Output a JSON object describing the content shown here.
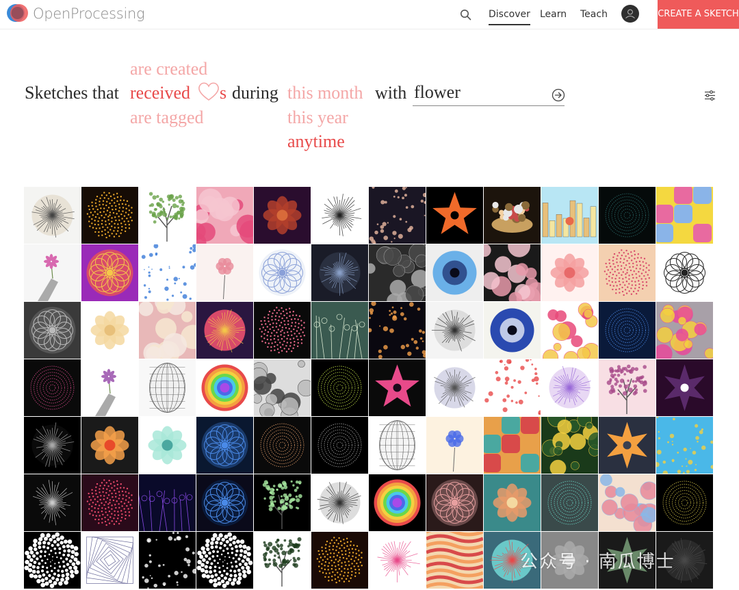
{
  "header": {
    "logo_text": "OpenProcessing",
    "nav": [
      {
        "label": "Discover",
        "active": true
      },
      {
        "label": "Learn",
        "active": false
      },
      {
        "label": "Teach",
        "active": false
      }
    ],
    "search_icon": "search-icon",
    "avatar_icon": "user-avatar-icon",
    "create_button": "CREATE A SKETCH",
    "accent_color": "#ef5a5a"
  },
  "query": {
    "prefix": "Sketches that",
    "action_options_above": [
      "are created"
    ],
    "action_selected": "received",
    "action_heart_icon": "heart-icon",
    "action_suffix": "s",
    "action_options_below": [
      "are tagged"
    ],
    "during": "during",
    "time_selected": "this month",
    "time_options_below": [
      "this year",
      "anytime"
    ],
    "with": "with",
    "search_value": "flower",
    "search_go_icon": "arrow-right-circle-icon",
    "filter_icon": "sliders-icon"
  },
  "grid": {
    "columns": 12,
    "rows": 7,
    "tiles": [
      {
        "bg": "#f4f4f2",
        "fg": "#e8e2d6",
        "mark": "#444",
        "kind": "burst"
      },
      {
        "bg": "#160c05",
        "fg": "#2a1a08",
        "mark": "#e8a62a",
        "kind": "dots"
      },
      {
        "bg": "#ffffff",
        "fg": "#ffffff",
        "mark": "#6aa24a",
        "kind": "tree"
      },
      {
        "bg": "#f0a8b8",
        "fg": "#f6c6d0",
        "mark": "#e44a7a",
        "kind": "petals"
      },
      {
        "bg": "#2a0d2e",
        "fg": "#b3402c",
        "mark": "#d86a3a",
        "kind": "bloom"
      },
      {
        "bg": "#ffffff",
        "fg": "#ffffff",
        "mark": "#222",
        "kind": "burst"
      },
      {
        "bg": "#1a1624",
        "fg": "#1a1624",
        "mark": "#e8b8a0",
        "kind": "scatter"
      },
      {
        "bg": "#000000",
        "fg": "#000000",
        "mark": "#f06a2a",
        "kind": "star5"
      },
      {
        "bg": "#1c140c",
        "fg": "#3a2a16",
        "mark": "#c8a060",
        "kind": "basket"
      },
      {
        "bg": "#b8e6f4",
        "fg": "#f4e6a0",
        "mark": "#e86a4a",
        "kind": "city"
      },
      {
        "bg": "#050a0a",
        "fg": "#0c1616",
        "mark": "#2a6a6a",
        "kind": "rings"
      },
      {
        "bg": "#f4d840",
        "fg": "#e86aa0",
        "mark": "#8ab4e8",
        "kind": "blocks"
      },
      {
        "bg": "#f6f6f6",
        "fg": "#dddddd",
        "mark": "#d86ab0",
        "kind": "hand"
      },
      {
        "bg": "#9a2ab8",
        "fg": "#d84a6a",
        "mark": "#f4c84a",
        "kind": "mandala"
      },
      {
        "bg": "#ffffff",
        "fg": "#ffffff",
        "mark": "#3a7ad8",
        "kind": "scatter"
      },
      {
        "bg": "#faf2f0",
        "fg": "#faf2f0",
        "mark": "#e88a9a",
        "kind": "single"
      },
      {
        "bg": "#ffffff",
        "fg": "#eef2f8",
        "mark": "#8aa0d8",
        "kind": "mandala"
      },
      {
        "bg": "#1a1c28",
        "fg": "#2a3040",
        "mark": "#8aa0c8",
        "kind": "burst"
      },
      {
        "bg": "#2a2a2a",
        "fg": "#4a4a4a",
        "mark": "#aaaaaa",
        "kind": "bubbles"
      },
      {
        "bg": "#eeeeee",
        "fg": "#6ab0e8",
        "mark": "#1a2a6a",
        "kind": "eye"
      },
      {
        "bg": "#1a1a1a",
        "fg": "#f4c6d0",
        "mark": "#e89aaa",
        "kind": "petals"
      },
      {
        "bg": "#fff2f0",
        "fg": "#f4a0a0",
        "mark": "#e86a6a",
        "kind": "bloom"
      },
      {
        "bg": "#f4d0b0",
        "fg": "#e8a07a",
        "mark": "#d84a6a",
        "kind": "dots"
      },
      {
        "bg": "#ffffff",
        "fg": "#ffffff",
        "mark": "#222",
        "kind": "mandala"
      },
      {
        "bg": "#3a3a3a",
        "fg": "#555",
        "mark": "#bbbbbb",
        "kind": "mandala"
      },
      {
        "bg": "#ffffff",
        "fg": "#f4d8a0",
        "mark": "#e8c07a",
        "kind": "bloom"
      },
      {
        "bg": "#e8b8b8",
        "fg": "#f4e8e0",
        "mark": "#f6e6d0",
        "kind": "petals"
      },
      {
        "bg": "#2a1640",
        "fg": "#d84a6a",
        "mark": "#f4c84a",
        "kind": "burst"
      },
      {
        "bg": "#0a0a0a",
        "fg": "#1a0a10",
        "mark": "#e86a8a",
        "kind": "dots"
      },
      {
        "bg": "#3a5a50",
        "fg": "#4a6a60",
        "mark": "#d8e8d0",
        "kind": "stems"
      },
      {
        "bg": "#0a0810",
        "fg": "#0a0810",
        "mark": "#f4a04a",
        "kind": "scatter"
      },
      {
        "bg": "#f4f4f4",
        "fg": "#dddddd",
        "mark": "#333",
        "kind": "burst"
      },
      {
        "bg": "#f4f4ee",
        "fg": "#2a4ab0",
        "mark": "#ffffff",
        "kind": "eye"
      },
      {
        "bg": "#ffffff",
        "fg": "#f4c84a",
        "mark": "#e84a7a",
        "kind": "bubbles"
      },
      {
        "bg": "#0a1a3a",
        "fg": "#1a3a8a",
        "mark": "#4a8ae8",
        "kind": "rings"
      },
      {
        "bg": "#a8a0a8",
        "fg": "#f4d040",
        "mark": "#e84a9a",
        "kind": "bubbles"
      },
      {
        "bg": "#0a0a0a",
        "fg": "#2a0a1a",
        "mark": "#d84a8a",
        "kind": "rings"
      },
      {
        "bg": "#ffffff",
        "fg": "#f2f2f2",
        "mark": "#a86ab8",
        "kind": "hand"
      },
      {
        "bg": "#f8f8f8",
        "fg": "#f0f0f0",
        "mark": "#555",
        "kind": "mesh"
      },
      {
        "bg": "#ffffff",
        "fg": "#4ac8a0",
        "mark": "#e84a6a",
        "kind": "rainbow"
      },
      {
        "bg": "#dddddd",
        "fg": "#bbbbbb",
        "mark": "#444",
        "kind": "bubbles"
      },
      {
        "bg": "#000000",
        "fg": "#0a1a0a",
        "mark": "#c8e84a",
        "kind": "rings"
      },
      {
        "bg": "#0a0a0a",
        "fg": "#1a0a1a",
        "mark": "#e84a8a",
        "kind": "star5"
      },
      {
        "bg": "#ffffff",
        "fg": "#d8d8e8",
        "mark": "#555",
        "kind": "burst"
      },
      {
        "bg": "#ffffff",
        "fg": "#ffffff",
        "mark": "#e84a4a",
        "kind": "scatter"
      },
      {
        "bg": "#ffffff",
        "fg": "#e8d8f4",
        "mark": "#9a6ad8",
        "kind": "burst"
      },
      {
        "bg": "#f8dfe4",
        "fg": "#f8dfe4",
        "mark": "#a84a8a",
        "kind": "tree"
      },
      {
        "bg": "#2a0a2a",
        "fg": "#ffffff",
        "mark": "#5a2a6a",
        "kind": "star6"
      },
      {
        "bg": "#000000",
        "fg": "#0a0a0a",
        "mark": "#aaaaaa",
        "kind": "burst"
      },
      {
        "bg": "#1a1a1a",
        "fg": "#f4a04a",
        "mark": "#e84a2a",
        "kind": "bloom"
      },
      {
        "bg": "#ffffff",
        "fg": "#a8e8d8",
        "mark": "#4aa8a0",
        "kind": "bloom"
      },
      {
        "bg": "#0a1830",
        "fg": "#1a3a6a",
        "mark": "#4a8ae8",
        "kind": "mandala"
      },
      {
        "bg": "#0a0a0a",
        "fg": "#1a0a0a",
        "mark": "#e8a06a",
        "kind": "rings"
      },
      {
        "bg": "#000000",
        "fg": "#0a0a0a",
        "mark": "#aaaaaa",
        "kind": "rings"
      },
      {
        "bg": "#ffffff",
        "fg": "#f4f4f4",
        "mark": "#555",
        "kind": "mesh"
      },
      {
        "bg": "#fdf2e0",
        "fg": "#fdf2e0",
        "mark": "#4a6ae8",
        "kind": "single"
      },
      {
        "bg": "#e8a04a",
        "fg": "#4aa8a0",
        "mark": "#d84a4a",
        "kind": "blocks"
      },
      {
        "bg": "#1a3a1a",
        "fg": "#2a5a2a",
        "mark": "#f4d040",
        "kind": "bubbles"
      },
      {
        "bg": "#2a3040",
        "fg": "#3a4050",
        "mark": "#f4a040",
        "kind": "star6"
      },
      {
        "bg": "#4ab8e8",
        "fg": "#6ac8f4",
        "mark": "#f4d040",
        "kind": "scatter"
      },
      {
        "bg": "#0a0a0a",
        "fg": "#0a0a0a",
        "mark": "#cccccc",
        "kind": "burst"
      },
      {
        "bg": "#2a0a1a",
        "fg": "#4a1a3a",
        "mark": "#e84a6a",
        "kind": "dots"
      },
      {
        "bg": "#0a0a2a",
        "fg": "#1a1a4a",
        "mark": "#8a4ae8",
        "kind": "stems"
      },
      {
        "bg": "#0a0a1a",
        "fg": "#0a1a3a",
        "mark": "#4a8ae8",
        "kind": "mandala"
      },
      {
        "bg": "#000000",
        "fg": "#0a0a0a",
        "mark": "#a8e8a0",
        "kind": "tree"
      },
      {
        "bg": "#ffffff",
        "fg": "#dddddd",
        "mark": "#333",
        "kind": "burst"
      },
      {
        "bg": "#000000",
        "fg": "#0a0a0a",
        "mark": "#f4a040",
        "kind": "rainbow"
      },
      {
        "bg": "#2a1a1a",
        "fg": "#6a4a4a",
        "mark": "#e8a0a0",
        "kind": "mandala"
      },
      {
        "bg": "#3a8a8a",
        "fg": "#e89a6a",
        "mark": "#f4d8a0",
        "kind": "bloom"
      },
      {
        "bg": "#3a4a4a",
        "fg": "#4a5a5a",
        "mark": "#6ad8c8",
        "kind": "rings"
      },
      {
        "bg": "#f4e0d0",
        "fg": "#e88a9a",
        "mark": "#8ab8e8",
        "kind": "bubbles"
      },
      {
        "bg": "#000000",
        "fg": "#0a0a0a",
        "mark": "#d8c84a",
        "kind": "rings"
      },
      {
        "bg": "#000000",
        "fg": "#ffffff",
        "mark": "#ffffff",
        "kind": "spiral"
      },
      {
        "bg": "#ffffff",
        "fg": "#e8e8f0",
        "mark": "#6a6a9a",
        "kind": "squares"
      },
      {
        "bg": "#000000",
        "fg": "#0a0a0a",
        "mark": "#ffffff",
        "kind": "scatter"
      },
      {
        "bg": "#000000",
        "fg": "#ffffff",
        "mark": "#ffffff",
        "kind": "spiral"
      },
      {
        "bg": "#ffffff",
        "fg": "#ffffff",
        "mark": "#1a3a1a",
        "kind": "tree"
      },
      {
        "bg": "#1a0a05",
        "fg": "#2a1a08",
        "mark": "#e8a62a",
        "kind": "dots"
      },
      {
        "bg": "#ffffff",
        "fg": "#ffffff",
        "mark": "#e84a8a",
        "kind": "burst"
      },
      {
        "bg": "#f4d8b0",
        "fg": "#d84a4a",
        "mark": "#f4a060",
        "kind": "waves"
      },
      {
        "bg": "#3a6a7a",
        "fg": "#6ac8c8",
        "mark": "#e84a4a",
        "kind": "burst"
      },
      {
        "bg": "#888888",
        "fg": "#aaaaaa",
        "mark": "#dddddd",
        "kind": "bloom"
      },
      {
        "bg": "#1a1a1a",
        "fg": "#2a2a2a",
        "mark": "#6a8a6a",
        "kind": "star6"
      },
      {
        "bg": "#1a1a1a",
        "fg": "#2a2a2a",
        "mark": "#4a4a4a",
        "kind": "burst"
      }
    ]
  },
  "watermark": "公众号 · 南瓜博士"
}
